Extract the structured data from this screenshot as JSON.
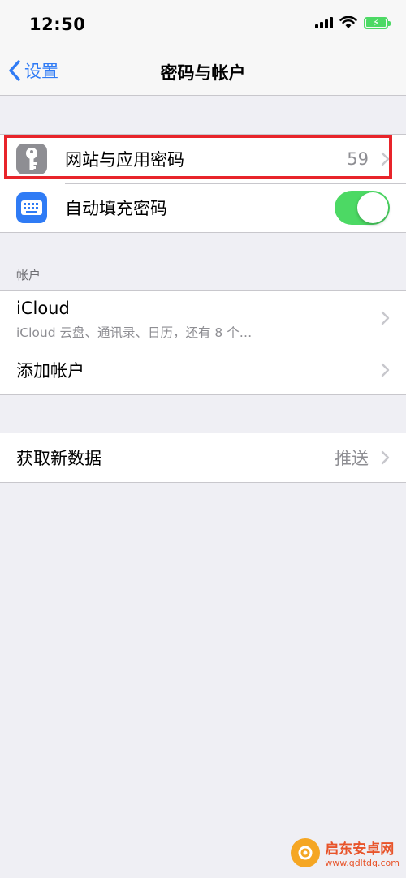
{
  "status_bar": {
    "time": "12:50"
  },
  "nav": {
    "back_label": "设置",
    "title": "密码与帐户"
  },
  "group1": {
    "passwords": {
      "label": "网站与应用密码",
      "value": "59",
      "icon": "key-icon"
    },
    "autofill": {
      "label": "自动填充密码",
      "icon": "keyboard-icon",
      "toggle_on": true
    }
  },
  "accounts": {
    "header": "帐户",
    "icloud": {
      "title": "iCloud",
      "subtitle": "iCloud 云盘、通讯录、日历，还有 8 个…"
    },
    "add_account": {
      "label": "添加帐户"
    }
  },
  "fetch": {
    "label": "获取新数据",
    "value": "推送"
  },
  "watermark": {
    "title": "启东安卓网",
    "url": "www.qdltdq.com"
  },
  "colors": {
    "accent": "#2f7bf5",
    "toggle_on": "#4cd964",
    "highlight": "#e8242a",
    "key_icon_bg": "#8e8e93",
    "keyboard_icon_bg": "#2f7bf5"
  }
}
